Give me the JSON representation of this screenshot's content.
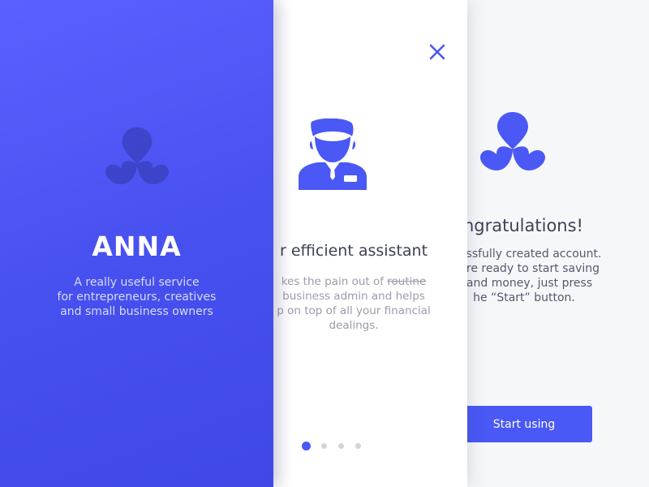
{
  "colors": {
    "brand_blue": "#4a58f6",
    "splash_gradient_start": "#5a60ff",
    "splash_gradient_end": "#3f48e6",
    "text_dark": "#3e4154",
    "text_muted": "#9a9daa"
  },
  "splash": {
    "logo_icon": "anna-trefoil-icon",
    "title": "ANNA",
    "tagline_lines": [
      "A really useful service",
      "for entrepreneurs, creatives",
      "and small business owners"
    ]
  },
  "assistant": {
    "close_icon": "close-icon",
    "illustration_icon": "person-icon",
    "title": "r efficient assistant",
    "body": {
      "line1_prefix": "kes the pain out of ",
      "line1_strike": "routine",
      "line2": "business admin and helps",
      "line3": "p on top of all your financial",
      "line4": "dealings."
    },
    "pagination": {
      "total": 4,
      "current": 1
    }
  },
  "congrats": {
    "logo_icon": "anna-trefoil-icon",
    "title": "ngratulations!",
    "body_lines": [
      "ccessfully created account.",
      "u are ready to start saving",
      "e and money, just press",
      "he “Start” button."
    ],
    "button_label": "Start using"
  }
}
